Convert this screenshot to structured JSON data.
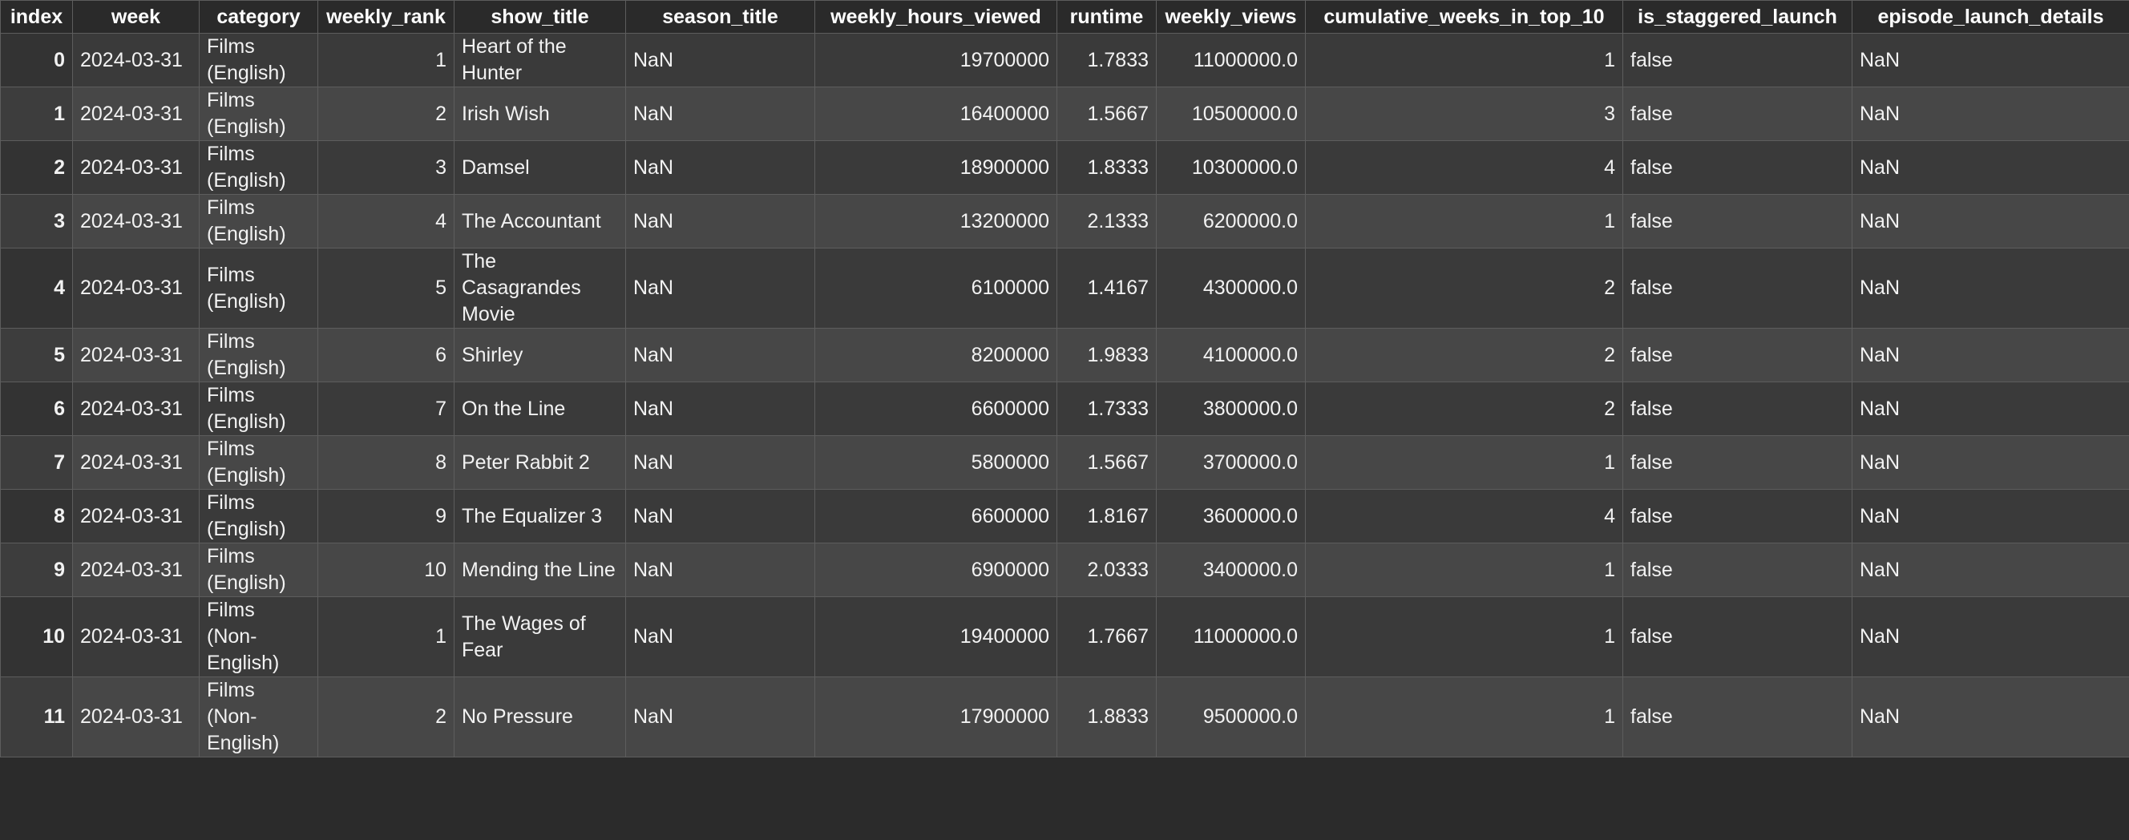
{
  "table": {
    "columns": [
      {
        "key": "index",
        "label": "index",
        "align": "idx"
      },
      {
        "key": "week",
        "label": "week",
        "align": "txt nowrap"
      },
      {
        "key": "category",
        "label": "category",
        "align": "txt"
      },
      {
        "key": "weekly_rank",
        "label": "weekly_rank",
        "align": "num"
      },
      {
        "key": "show_title",
        "label": "show_title",
        "align": "txt"
      },
      {
        "key": "season_title",
        "label": "season_title",
        "align": "txt"
      },
      {
        "key": "weekly_hours_viewed",
        "label": "weekly_hours_viewed",
        "align": "num"
      },
      {
        "key": "runtime",
        "label": "runtime",
        "align": "num"
      },
      {
        "key": "weekly_views",
        "label": "weekly_views",
        "align": "num"
      },
      {
        "key": "cumulative_weeks_in_top_10",
        "label": "cumulative_weeks_in_top_10",
        "align": "num"
      },
      {
        "key": "is_staggered_launch",
        "label": "is_staggered_launch",
        "align": "txt"
      },
      {
        "key": "episode_launch_details",
        "label": "episode_launch_details",
        "align": "txt"
      }
    ],
    "rows": [
      {
        "index": "0",
        "week": "2024-03-31",
        "category": "Films (English)",
        "weekly_rank": "1",
        "show_title": "Heart of the Hunter",
        "season_title": "NaN",
        "weekly_hours_viewed": "19700000",
        "runtime": "1.7833",
        "weekly_views": "11000000.0",
        "cumulative_weeks_in_top_10": "1",
        "is_staggered_launch": "false",
        "episode_launch_details": "NaN"
      },
      {
        "index": "1",
        "week": "2024-03-31",
        "category": "Films (English)",
        "weekly_rank": "2",
        "show_title": "Irish Wish",
        "season_title": "NaN",
        "weekly_hours_viewed": "16400000",
        "runtime": "1.5667",
        "weekly_views": "10500000.0",
        "cumulative_weeks_in_top_10": "3",
        "is_staggered_launch": "false",
        "episode_launch_details": "NaN"
      },
      {
        "index": "2",
        "week": "2024-03-31",
        "category": "Films (English)",
        "weekly_rank": "3",
        "show_title": "Damsel",
        "season_title": "NaN",
        "weekly_hours_viewed": "18900000",
        "runtime": "1.8333",
        "weekly_views": "10300000.0",
        "cumulative_weeks_in_top_10": "4",
        "is_staggered_launch": "false",
        "episode_launch_details": "NaN"
      },
      {
        "index": "3",
        "week": "2024-03-31",
        "category": "Films (English)",
        "weekly_rank": "4",
        "show_title": "The Accountant",
        "season_title": "NaN",
        "weekly_hours_viewed": "13200000",
        "runtime": "2.1333",
        "weekly_views": "6200000.0",
        "cumulative_weeks_in_top_10": "1",
        "is_staggered_launch": "false",
        "episode_launch_details": "NaN"
      },
      {
        "index": "4",
        "week": "2024-03-31",
        "category": "Films (English)",
        "weekly_rank": "5",
        "show_title": "The Casagrandes Movie",
        "season_title": "NaN",
        "weekly_hours_viewed": "6100000",
        "runtime": "1.4167",
        "weekly_views": "4300000.0",
        "cumulative_weeks_in_top_10": "2",
        "is_staggered_launch": "false",
        "episode_launch_details": "NaN"
      },
      {
        "index": "5",
        "week": "2024-03-31",
        "category": "Films (English)",
        "weekly_rank": "6",
        "show_title": "Shirley",
        "season_title": "NaN",
        "weekly_hours_viewed": "8200000",
        "runtime": "1.9833",
        "weekly_views": "4100000.0",
        "cumulative_weeks_in_top_10": "2",
        "is_staggered_launch": "false",
        "episode_launch_details": "NaN"
      },
      {
        "index": "6",
        "week": "2024-03-31",
        "category": "Films (English)",
        "weekly_rank": "7",
        "show_title": "On the Line",
        "season_title": "NaN",
        "weekly_hours_viewed": "6600000",
        "runtime": "1.7333",
        "weekly_views": "3800000.0",
        "cumulative_weeks_in_top_10": "2",
        "is_staggered_launch": "false",
        "episode_launch_details": "NaN"
      },
      {
        "index": "7",
        "week": "2024-03-31",
        "category": "Films (English)",
        "weekly_rank": "8",
        "show_title": "Peter Rabbit 2",
        "season_title": "NaN",
        "weekly_hours_viewed": "5800000",
        "runtime": "1.5667",
        "weekly_views": "3700000.0",
        "cumulative_weeks_in_top_10": "1",
        "is_staggered_launch": "false",
        "episode_launch_details": "NaN"
      },
      {
        "index": "8",
        "week": "2024-03-31",
        "category": "Films (English)",
        "weekly_rank": "9",
        "show_title": "The Equalizer 3",
        "season_title": "NaN",
        "weekly_hours_viewed": "6600000",
        "runtime": "1.8167",
        "weekly_views": "3600000.0",
        "cumulative_weeks_in_top_10": "4",
        "is_staggered_launch": "false",
        "episode_launch_details": "NaN"
      },
      {
        "index": "9",
        "week": "2024-03-31",
        "category": "Films (English)",
        "weekly_rank": "10",
        "show_title": "Mending the Line",
        "season_title": "NaN",
        "weekly_hours_viewed": "6900000",
        "runtime": "2.0333",
        "weekly_views": "3400000.0",
        "cumulative_weeks_in_top_10": "1",
        "is_staggered_launch": "false",
        "episode_launch_details": "NaN"
      },
      {
        "index": "10",
        "week": "2024-03-31",
        "category": "Films (Non-English)",
        "weekly_rank": "1",
        "show_title": "The Wages of Fear",
        "season_title": "NaN",
        "weekly_hours_viewed": "19400000",
        "runtime": "1.7667",
        "weekly_views": "11000000.0",
        "cumulative_weeks_in_top_10": "1",
        "is_staggered_launch": "false",
        "episode_launch_details": "NaN"
      },
      {
        "index": "11",
        "week": "2024-03-31",
        "category": "Films (Non-English)",
        "weekly_rank": "2",
        "show_title": "No Pressure",
        "season_title": "NaN",
        "weekly_hours_viewed": "17900000",
        "runtime": "1.8833",
        "weekly_views": "9500000.0",
        "cumulative_weeks_in_top_10": "1",
        "is_staggered_launch": "false",
        "episode_launch_details": "NaN"
      }
    ]
  }
}
